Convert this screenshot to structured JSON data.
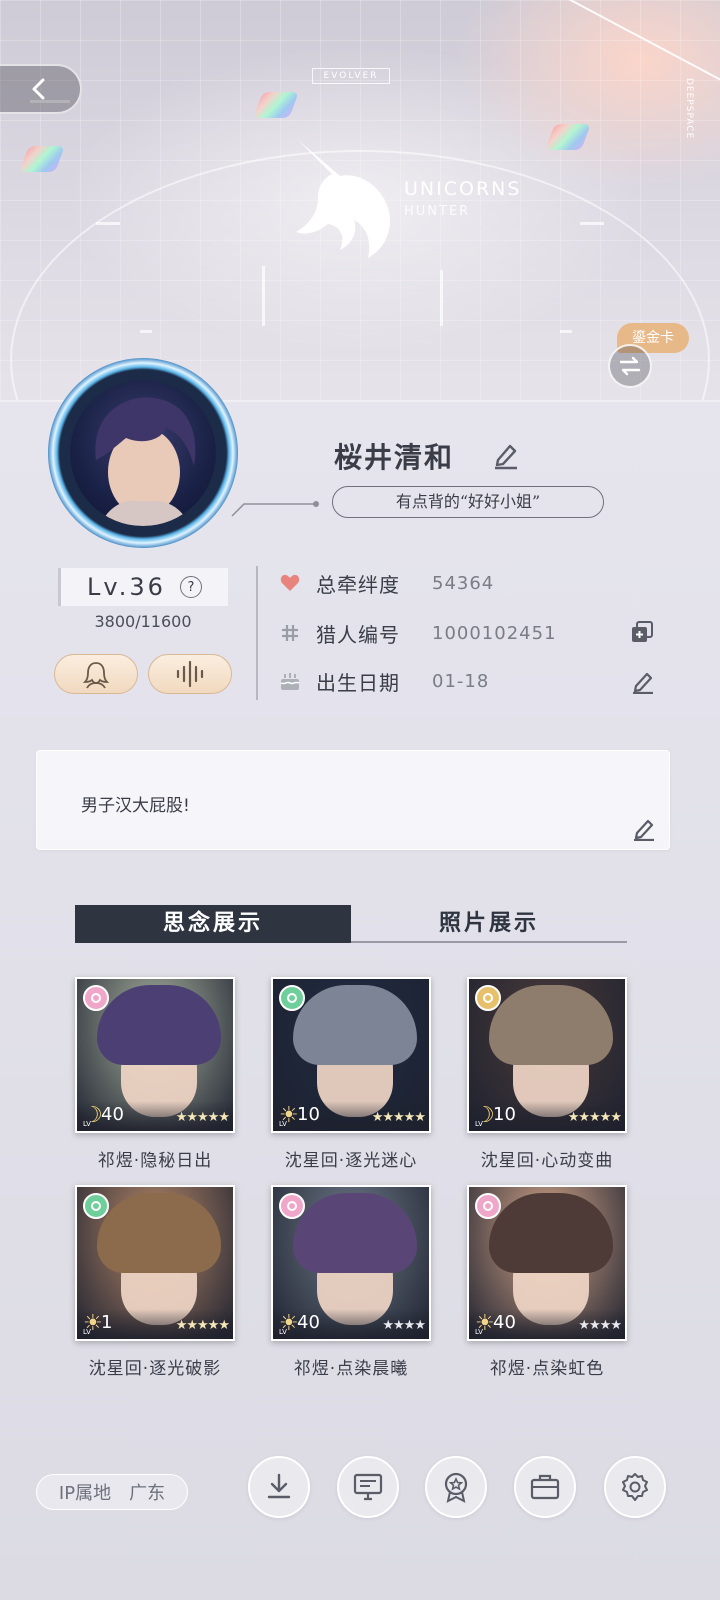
{
  "banner": {
    "evolver_tag": "EVOLVER",
    "brand_vertical": "DEEPSPACE",
    "logo_line1": "UNICORNS",
    "logo_line2": "HUNTER",
    "cert_tag": "鎏金卡"
  },
  "profile": {
    "name": "桜井清和",
    "signature": "有点背的“好好小姐”",
    "level": "Lv.36",
    "help_glyph": "?",
    "exp": "3800/11600"
  },
  "stats": [
    {
      "label": "总牵绊度",
      "value": "54364",
      "icon": "heart-icon"
    },
    {
      "label": "猎人编号",
      "value": "1000102451",
      "icon": "hash-icon"
    },
    {
      "label": "出生日期",
      "value": "01-18",
      "icon": "cake-icon"
    }
  ],
  "bio": {
    "text": "男子汉大屁股!"
  },
  "tabs": [
    {
      "label": "思念展示",
      "active": true
    },
    {
      "label": "照片展示",
      "active": false
    }
  ],
  "cards": [
    {
      "title": "祁煜·隐秘日出",
      "level": "40",
      "moon": true,
      "badge_color": "#f0a6c8",
      "stars": "★★★★★",
      "hair": "#4b3f74",
      "bg": "#a9b3a0"
    },
    {
      "title": "沈星回·逐光迷心",
      "level": "10",
      "moon": false,
      "badge_color": "#6fcf9a",
      "stars": "★★★★★",
      "hair": "#7d8496",
      "bg": "#1f2a40"
    },
    {
      "title": "沈星回·心动变曲",
      "level": "10",
      "moon": true,
      "badge_color": "#e6c06a",
      "stars": "★★★★★",
      "hair": "#8e7d6c",
      "bg": "#4a3a38"
    },
    {
      "title": "沈星回·逐光破影",
      "level": "1",
      "moon": false,
      "badge_color": "#6fcf9a",
      "stars": "★★★★★",
      "hair": "#8c6b4c",
      "bg": "#b8896a"
    },
    {
      "title": "祁煜·点染晨曦",
      "level": "40",
      "moon": false,
      "badge_color": "#f0a6c8",
      "stars": "★★★★",
      "hair": "#5a4676",
      "bg": "#6e7a88"
    },
    {
      "title": "祁煜·点染虹色",
      "level": "40",
      "moon": false,
      "badge_color": "#f0a6c8",
      "stars": "★★★★",
      "hair": "#4e3a36",
      "bg": "#d8a88a"
    }
  ],
  "footer": {
    "ip_label": "IP属地",
    "ip_value": "广东"
  },
  "colors": {
    "accent_dark": "#2e3440",
    "heart": "#e8837e",
    "cert_tag": "#e8b988"
  }
}
